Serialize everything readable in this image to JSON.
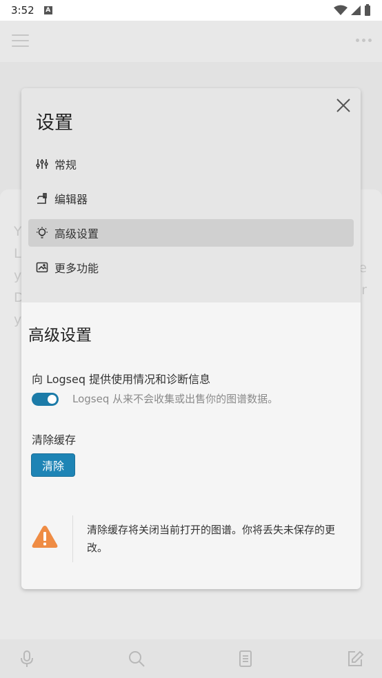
{
  "status_bar": {
    "time": "3:52",
    "notification_badge": "A"
  },
  "background": {
    "text_left": [
      "Y",
      "L",
      "y",
      "D",
      "y"
    ],
    "text_right": [
      "e",
      "r"
    ]
  },
  "modal": {
    "title": "设置",
    "nav_items": [
      {
        "label": "常规",
        "icon": "sliders-icon",
        "active": false
      },
      {
        "label": "编辑器",
        "icon": "editor-icon",
        "active": false
      },
      {
        "label": "高级设置",
        "icon": "lightbulb-icon",
        "active": true
      },
      {
        "label": "更多功能",
        "icon": "image-icon",
        "active": false
      }
    ],
    "section_title": "高级设置",
    "telemetry": {
      "label": "向 Logseq 提供使用情况和诊断信息",
      "enabled": true,
      "description": "Logseq 从来不会收集或出售你的图谱数据。"
    },
    "cache": {
      "label": "清除缓存",
      "button_label": "清除"
    },
    "warning": {
      "text": "清除缓存将关闭当前打开的图谱。你将丢失未保存的更改。"
    }
  },
  "colors": {
    "accent": "#1e84b5",
    "warning": "#ef8c44"
  }
}
